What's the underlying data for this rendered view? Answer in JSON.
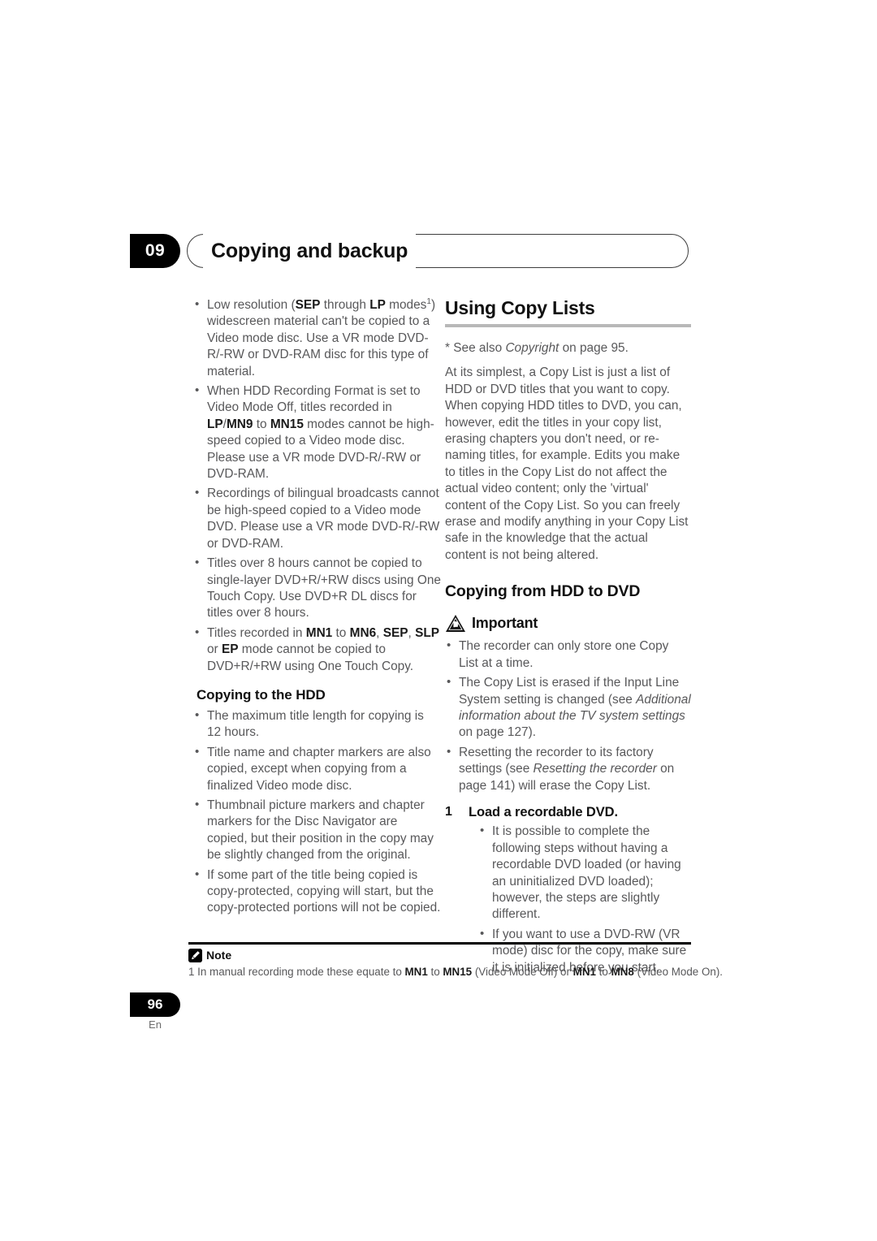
{
  "header": {
    "chapter_number": "09",
    "chapter_title": "Copying and backup"
  },
  "left_column": {
    "bullets_continued": [
      "Low resolution (<b>SEP</b> through <b>LP</b> modes<sup>1</sup>) widescreen material can't be copied to a Video mode disc. Use a VR mode DVD-R/-RW or DVD-RAM disc for this type of material.",
      "When HDD Recording Format is set to Video Mode Off, titles recorded in <b>LP</b>/<b>MN9</b> to <b>MN15</b> modes cannot be high-speed copied to a Video mode disc. Please use a VR mode DVD-R/-RW or DVD-RAM.",
      "Recordings of bilingual broadcasts cannot be high-speed copied to a Video mode DVD. Please use a VR mode DVD-R/-RW or DVD-RAM.",
      "Titles over 8 hours cannot be copied to single-layer DVD+R/+RW discs using One Touch Copy. Use DVD+R DL discs for titles over 8 hours.",
      "Titles recorded in <b>MN1</b> to <b>MN6</b>, <b>SEP</b>, <b>SLP</b> or <b>EP</b> mode cannot be copied to DVD+R/+RW using One Touch Copy."
    ],
    "subheading": "Copying to the HDD",
    "hdd_bullets": [
      "The maximum title length for copying is 12 hours.",
      "Title name and chapter markers are also copied, except when copying from a finalized Video mode disc.",
      "Thumbnail picture markers and chapter markers for the Disc Navigator are copied, but their position in the copy may be slightly changed from the original.",
      "If some part of the title being copied is copy-protected, copying will start, but the copy-protected portions will not be copied."
    ]
  },
  "right_column": {
    "section_title": "Using Copy Lists",
    "footnote_ref": "* See also <i>Copyright</i> on page 95.",
    "intro_paragraph": "At its simplest, a Copy List is just a list of HDD or DVD titles that you want to copy. When copying HDD titles to DVD, you can, however, edit the titles in your copy list, erasing chapters you don't need, or re-naming titles, for example. Edits you make to titles in the Copy List do not affect the actual video content; only the 'virtual' content of the Copy List. So you can freely erase and modify anything in your Copy List safe in the knowledge that the actual content is not being altered.",
    "subsection_title": "Copying from HDD to DVD",
    "important_label": "Important",
    "important_bullets": [
      "The recorder can only store one Copy List at a time.",
      "The Copy List is erased if the Input Line System setting is changed (see <i>Additional information about the TV system settings</i> on page 127).",
      "Resetting the recorder to its factory settings (see <i>Resetting the recorder</i> on page 141) will erase the Copy List."
    ],
    "step_number": "1",
    "step_title": "Load a recordable DVD.",
    "step_bullets": [
      "It is possible to complete the following steps without having a recordable DVD loaded (or having an uninitialized DVD loaded); however, the steps are slightly different.",
      "If you want to use a DVD-RW (VR mode) disc for the copy, make sure it is initialized before you start."
    ]
  },
  "footer": {
    "note_label": "Note",
    "note_text": "1 In manual recording mode these equate to <b>MN1</b> to <b>MN15</b> (Video Mode Off) or <b>MN1</b> to <b>MN8</b> (Video Mode On).",
    "page_number": "96",
    "language_code": "En"
  },
  "colors": {
    "body_text": "#58585a",
    "heading_text": "#111111",
    "rule_gray": "#b8b8b8",
    "badge_background": "#000000"
  }
}
